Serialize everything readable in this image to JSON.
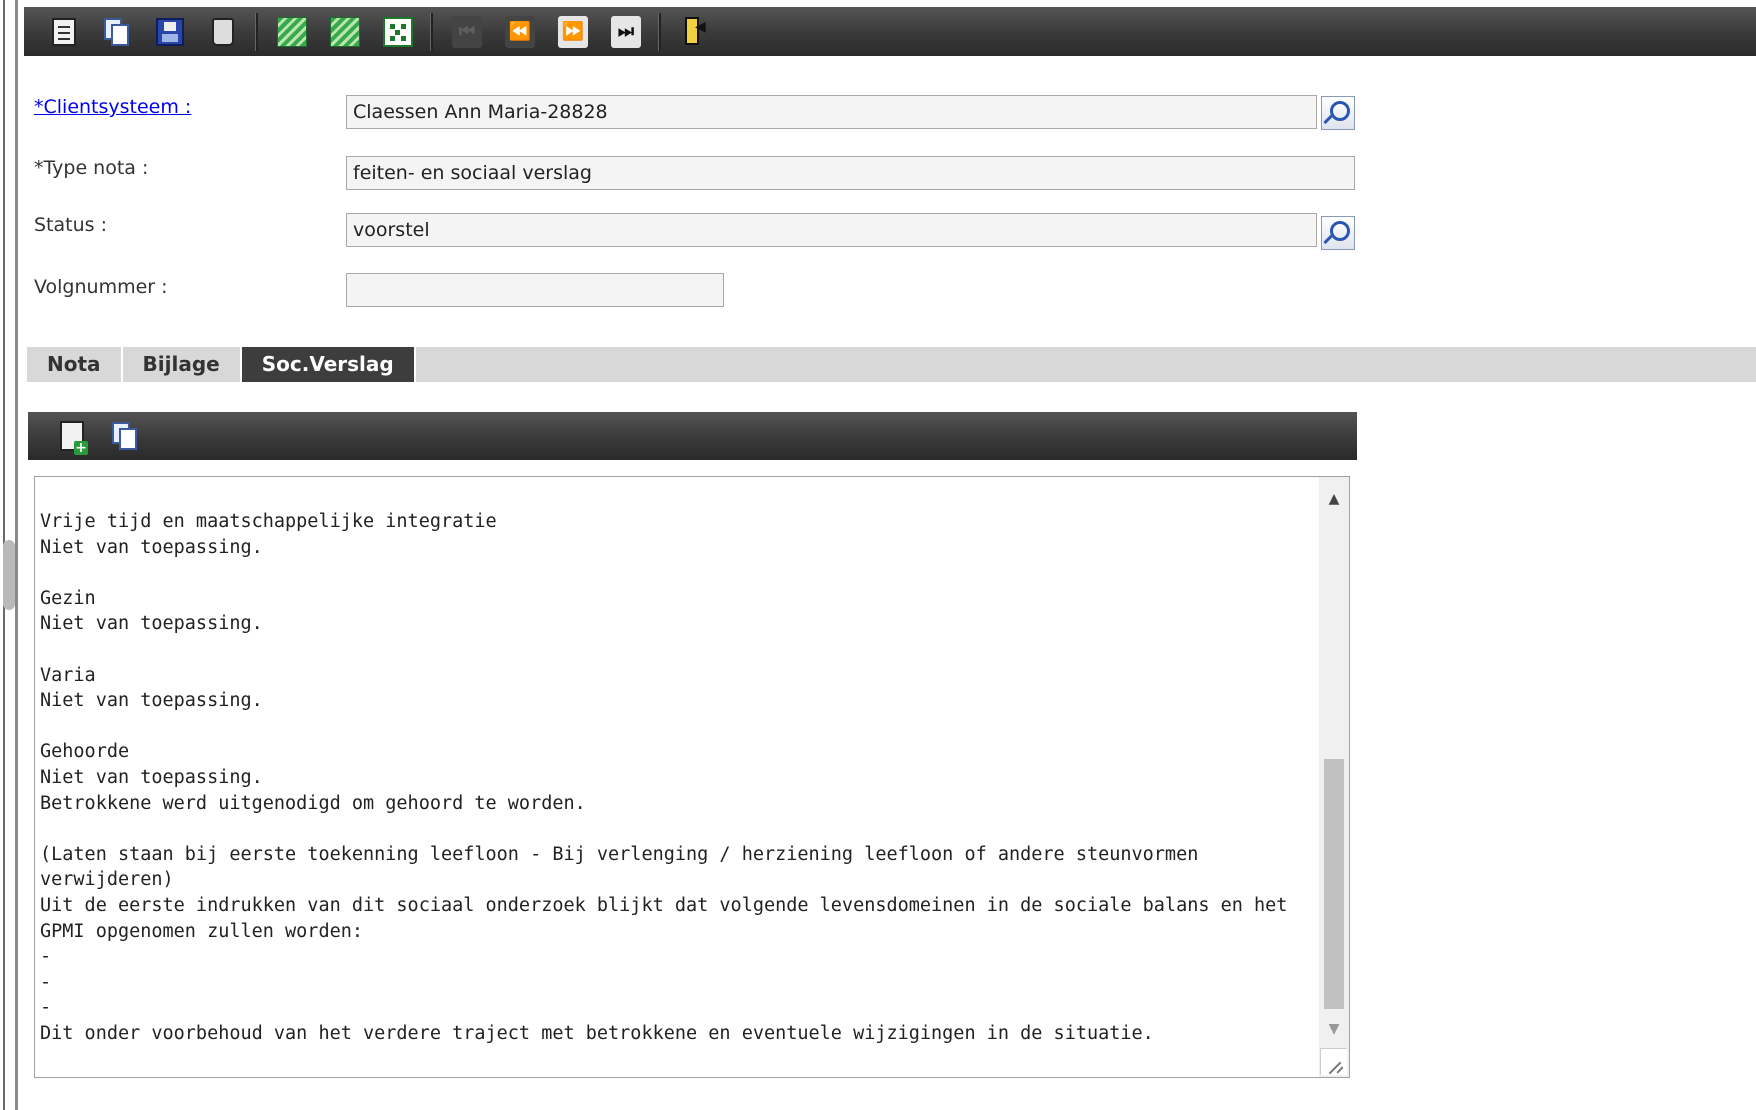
{
  "toolbar": {
    "buttons": [
      {
        "name": "new-document-icon"
      },
      {
        "name": "copy-icon"
      },
      {
        "name": "save-icon"
      },
      {
        "name": "delete-icon"
      },
      {
        "name": "green-action-1-icon"
      },
      {
        "name": "green-action-2-icon"
      },
      {
        "name": "dice-icon"
      },
      {
        "name": "first-record-icon",
        "glyph": "⏮",
        "enabled": false
      },
      {
        "name": "previous-record-icon",
        "glyph": "⏪",
        "enabled": false
      },
      {
        "name": "next-record-icon",
        "glyph": "⏩",
        "enabled": true
      },
      {
        "name": "last-record-icon",
        "glyph": "⏭",
        "enabled": true
      },
      {
        "name": "exit-icon"
      }
    ]
  },
  "form": {
    "clientsysteem": {
      "label": "*Clientsysteem :",
      "value": "Claessen Ann Maria-28828"
    },
    "type_nota": {
      "label": "*Type nota :",
      "value": "feiten- en sociaal verslag"
    },
    "status": {
      "label": "Status :",
      "value": "voorstel"
    },
    "volgnummer": {
      "label": "Volgnummer :",
      "value": ""
    }
  },
  "tabs": [
    {
      "label": "Nota",
      "active": false
    },
    {
      "label": "Bijlage",
      "active": false
    },
    {
      "label": "Soc.Verslag",
      "active": true
    }
  ],
  "report": {
    "text": "Vrije tijd en maatschappelijke integratie\nNiet van toepassing.\n\nGezin\nNiet van toepassing.\n\nVaria\nNiet van toepassing.\n\nGehoorde\nNiet van toepassing.\nBetrokkene werd uitgenodigd om gehoord te worden.\n\n(Laten staan bij eerste toekenning leefloon - Bij verlenging / herziening leefloon of andere steunvormen verwijderen)\nUit de eerste indrukken van dit sociaal onderzoek blijkt dat volgende levensdomeinen in de sociale balans en het GPMI opgenomen zullen worden:\n-\n-\n-\nDit onder voorbehoud van het verdere traject met betrokkene en eventuele wijzigingen in de situatie."
  },
  "colors": {
    "toolbar_bg": "#3c3c3c",
    "tab_active_bg": "#3d3d3d",
    "link": "#0000ee"
  }
}
